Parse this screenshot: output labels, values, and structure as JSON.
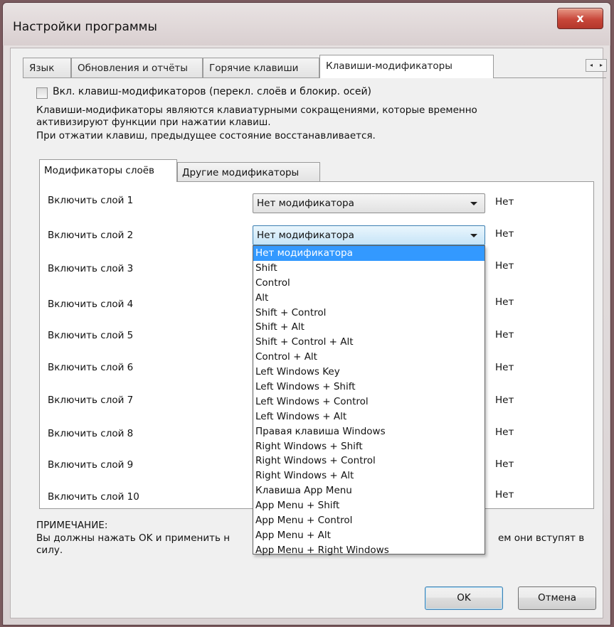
{
  "window": {
    "title": "Настройки программы",
    "close_label": "x"
  },
  "tabs": [
    {
      "label": "Язык"
    },
    {
      "label": "Обновления и отчёты"
    },
    {
      "label": "Горячие клавиши"
    },
    {
      "label": "Клавиши-модификаторы",
      "active": true
    }
  ],
  "tab_scroll": {
    "left": "◂",
    "right": "▸"
  },
  "enable_checkbox": {
    "label": "Вкл. клавиш-модификаторов (перекл. слоёв и блокир. осей)",
    "checked": false
  },
  "description": {
    "line1": "Клавиши-модификаторы являются клавиатурными сокращениями, которые временно",
    "line2": "активизируют функции при нажатии клавиш.",
    "line3": "При отжатии клавиш, предыдущее состояние восстанавливается."
  },
  "subtabs": [
    {
      "label": "Модификаторы слоёв",
      "active": true
    },
    {
      "label": "Другие модификаторы"
    }
  ],
  "layers": [
    {
      "label": "Включить слой 1",
      "value": "Нет модификатора",
      "state": "Нет"
    },
    {
      "label": "Включить слой 2",
      "value": "Нет модификатора",
      "state": "Нет",
      "open": true
    },
    {
      "label": "Включить слой 3",
      "state": "Нет"
    },
    {
      "label": "Включить слой 4",
      "state": "Нет"
    },
    {
      "label": "Включить слой 5",
      "state": "Нет"
    },
    {
      "label": "Включить слой 6",
      "state": "Нет"
    },
    {
      "label": "Включить слой 7",
      "state": "Нет"
    },
    {
      "label": "Включить слой 8",
      "state": "Нет"
    },
    {
      "label": "Включить слой 9",
      "state": "Нет"
    },
    {
      "label": "Включить слой 10",
      "state": "Нет"
    }
  ],
  "dropdown_options": [
    "Нет модификатора",
    "Shift",
    "Control",
    "Alt",
    "Shift + Control",
    "Shift + Alt",
    "Shift + Control + Alt",
    "Control + Alt",
    "Left Windows Key",
    "Left Windows + Shift",
    "Left Windows + Control",
    "Left Windows + Alt",
    "Правая клавиша Windows",
    "Right Windows + Shift",
    "Right Windows + Control",
    "Right Windows + Alt",
    "Клавиша App Menu",
    "App Menu + Shift",
    "App Menu + Control",
    "App Menu + Alt",
    "App Menu + Right Windows"
  ],
  "dropdown_selected": "Нет модификатора",
  "note": {
    "title": "ПРИМЕЧАНИЕ:",
    "text_start": "Вы должны нажать OK и применить н",
    "text_end_line1": "ем они вступят в",
    "text_end_line2": "силу."
  },
  "buttons": {
    "ok": "OK",
    "cancel": "Отмена"
  }
}
